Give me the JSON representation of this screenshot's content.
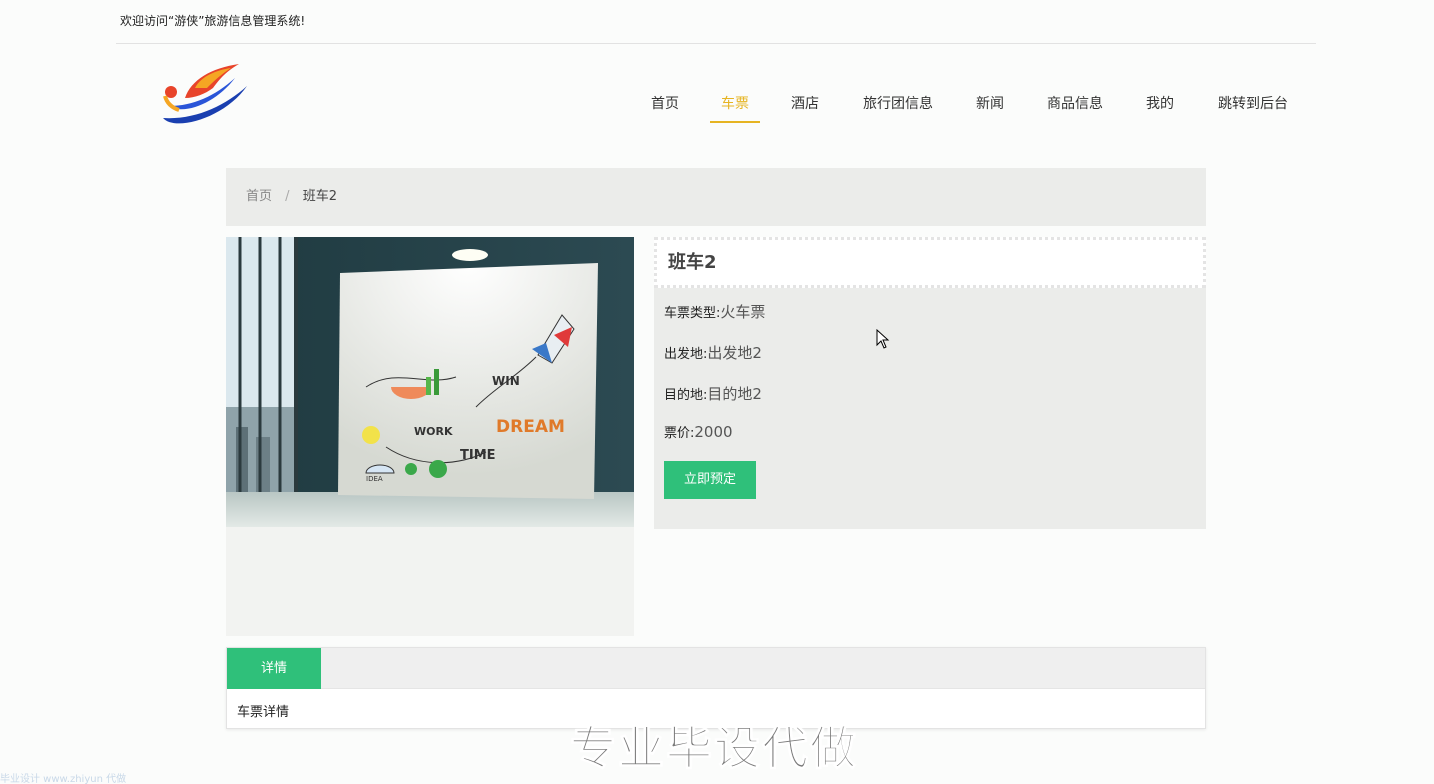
{
  "topbar": {
    "welcome": "欢迎访问“游侠”旅游信息管理系统!"
  },
  "nav": {
    "items": [
      {
        "label": "首页"
      },
      {
        "label": "车票"
      },
      {
        "label": "酒店"
      },
      {
        "label": "旅行团信息"
      },
      {
        "label": "新闻"
      },
      {
        "label": "商品信息"
      },
      {
        "label": "我的"
      },
      {
        "label": "跳转到后台"
      }
    ],
    "active": "车票",
    "accent": "#e6b422"
  },
  "breadcrumb": {
    "home": "首页",
    "separator": "/",
    "current": "班车2"
  },
  "product": {
    "title": "班车2",
    "fields": [
      {
        "label": "车票类型:",
        "value": "火车票"
      },
      {
        "label": "出发地:",
        "value": "出发地2"
      },
      {
        "label": "目的地:",
        "value": "目的地2"
      },
      {
        "label": "票价:",
        "value": "2000"
      }
    ],
    "book_button": "立即预定",
    "image_icon": "wall-doodle-image"
  },
  "tabs": {
    "active_label": "详情",
    "content": "车票详情"
  },
  "colors": {
    "primary": "#2fc07a",
    "panel": "#ebecea"
  },
  "watermark": {
    "text": "专业毕设代做",
    "small": "毕业设计 www.zhiyun 代做"
  }
}
